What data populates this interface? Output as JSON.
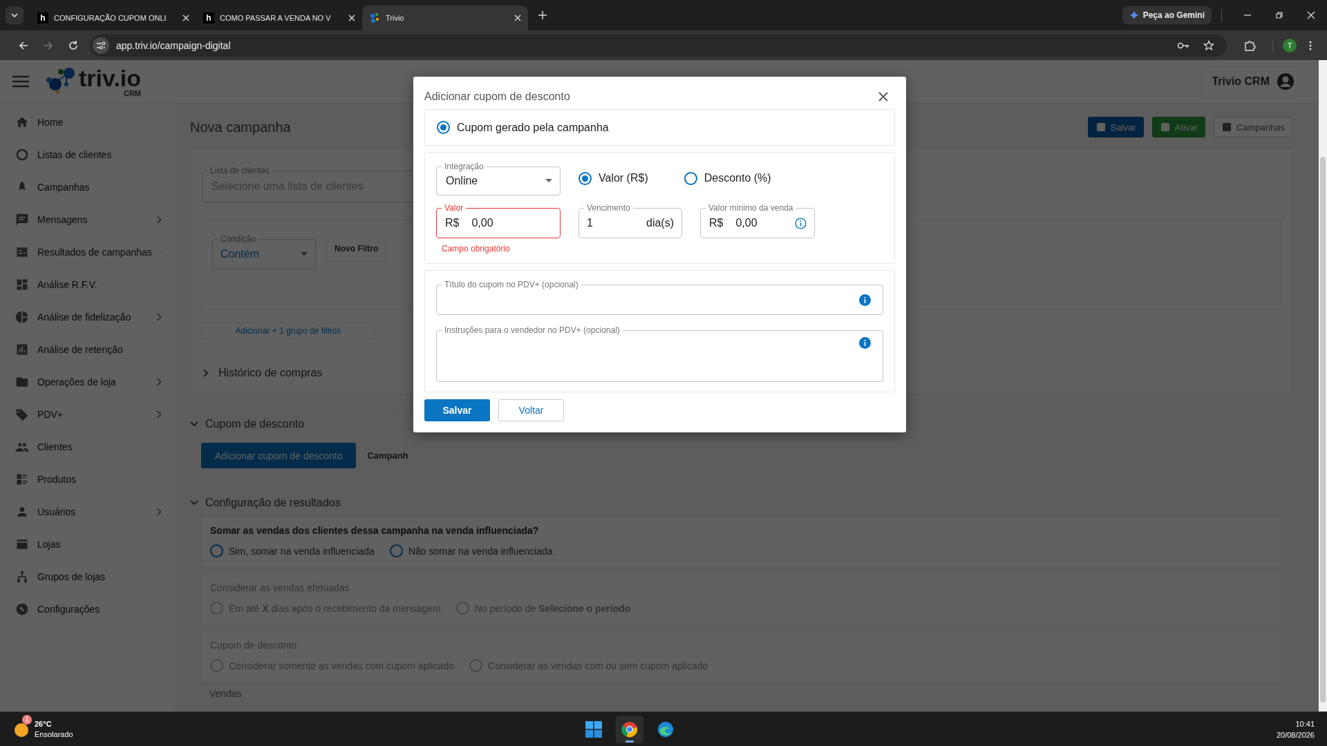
{
  "browser": {
    "tabs": [
      {
        "title": "CONFIGURAÇÃO CUPOM ONLI",
        "favicon": "h",
        "selected": false
      },
      {
        "title": "COMO PASSAR A VENDA NO V",
        "favicon": "h",
        "selected": false
      },
      {
        "title": "Trivio",
        "selected": true
      }
    ],
    "url": "app.triv.io/campaign-digital",
    "gemini": "Peça ao Gemini",
    "profile": "T"
  },
  "app": {
    "logo": "triv.io",
    "logo_sub": "CRM",
    "account": "Trivio CRM",
    "sidebar": [
      {
        "label": "Home",
        "expandable": false
      },
      {
        "label": "Listas de clientes",
        "expandable": false
      },
      {
        "label": "Campanhas",
        "expandable": false
      },
      {
        "label": "Mensagens",
        "expandable": true
      },
      {
        "label": "Resultados de campanhas",
        "expandable": true
      },
      {
        "label": "Análise R.F.V.",
        "expandable": false
      },
      {
        "label": "Análise de fidelização",
        "expandable": true
      },
      {
        "label": "Análise de retenção",
        "expandable": false
      },
      {
        "label": "Operações de loja",
        "expandable": true
      },
      {
        "label": "PDV+",
        "expandable": true
      },
      {
        "label": "Clientes",
        "expandable": false
      },
      {
        "label": "Produtos",
        "expandable": false
      },
      {
        "label": "Usuários",
        "expandable": true
      },
      {
        "label": "Lojas",
        "expandable": false
      },
      {
        "label": "Grupos de lojas",
        "expandable": false
      },
      {
        "label": "Configurações",
        "expandable": false
      }
    ],
    "page_title": "Nova campanha",
    "actions": [
      {
        "label": "Salvar",
        "kind": "save"
      },
      {
        "label": "Ativar",
        "kind": "activate"
      },
      {
        "label": "Campanhas",
        "kind": "campaigns"
      }
    ],
    "audience": {
      "list_field": {
        "label": "Lista de clientes",
        "placeholder": "Selecione uma lista de clientes"
      },
      "condition": {
        "label": "Condição",
        "value": "Contém"
      },
      "new_filter": "Novo Filtro",
      "add_group": "Adicionar + 1 grupo de filtros",
      "history": {
        "label": "Histórico de compras",
        "expanded": false
      }
    },
    "coupon_section": {
      "title": "Cupom de desconto",
      "expanded": true,
      "add_button": "Adicionar cupom de desconto",
      "tab": "Campanh"
    },
    "results_section": {
      "title": "Configuração de resultados",
      "expanded": true,
      "groups": [
        {
          "question": "Somar as vendas dos clientes dessa campanha na venda influenciada?",
          "enabled": true,
          "options": [
            {
              "label": "Sim, somar na venda influenciada",
              "selected": false
            },
            {
              "label": "Não somar na venda influenciada",
              "selected": false
            }
          ]
        },
        {
          "question": "Considerar as vendas efetuadas",
          "enabled": false,
          "options": [
            {
              "label": "Em até **X** dias após o recebimento da mensagem",
              "selected": false
            },
            {
              "label": "No período de **Selecione o período**",
              "selected": false
            }
          ]
        },
        {
          "question": "Cupom de desconto",
          "enabled": false,
          "options": [
            {
              "label": "Considerar somente as vendas com cupom aplicado",
              "selected": false
            },
            {
              "label": "Considerar as vendas com ou sem cupom aplicado",
              "selected": false
            }
          ]
        }
      ],
      "more": "Vendas"
    }
  },
  "modal": {
    "title": "Adicionar cupom de desconto",
    "source_option": {
      "label": "Cupom gerado pela campanha",
      "selected": true
    },
    "integration": {
      "label": "Integração",
      "value": "Online"
    },
    "type_options": [
      {
        "label": "Valor (R$)",
        "selected": true
      },
      {
        "label": "Desconto (%)",
        "selected": false
      }
    ],
    "value_field": {
      "label": "Valor",
      "prefix": "R$",
      "value": "0,00",
      "error": "Campo obrigatório"
    },
    "due_field": {
      "label": "Vencimento",
      "value": "1",
      "suffix": "dia(s)"
    },
    "min_field": {
      "label": "Valor mínimo da venda",
      "prefix": "R$",
      "value": "0,00"
    },
    "title_field": {
      "label": "Título do cupom no PDV+ (opcional)"
    },
    "instructions_field": {
      "label": "Instruções para o vendedor no PDV+ (opcional)"
    },
    "buttons": [
      {
        "label": "Salvar",
        "kind": "primary"
      },
      {
        "label": "Voltar",
        "kind": "secondary"
      }
    ]
  },
  "taskbar": {
    "temperature": "26°C",
    "weather": "Ensolarado",
    "badge": "1",
    "time": "10:41",
    "date": "20/08/2026"
  }
}
